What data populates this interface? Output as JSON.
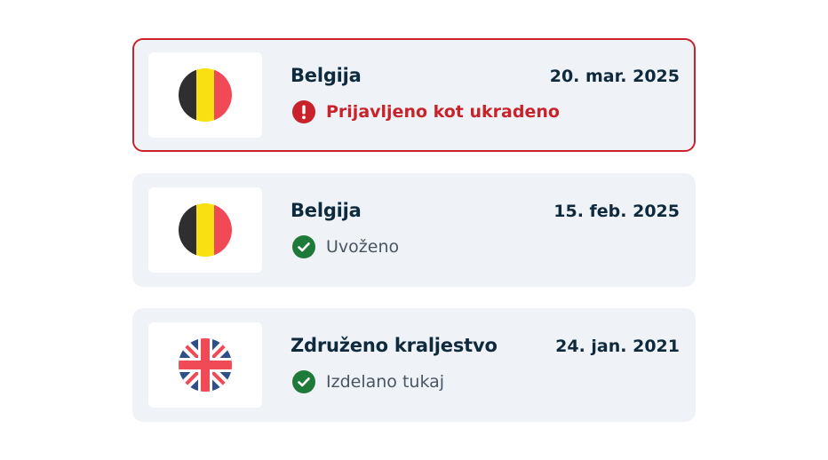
{
  "colors": {
    "card_bg": "#eff3f8",
    "alert_border": "#c8232b",
    "alert_text": "#c8232b",
    "success": "#1f7a3a",
    "heading": "#0f2a3d",
    "muted": "#4a5563"
  },
  "entries": [
    {
      "country": "Belgija",
      "date": "20. mar. 2025",
      "status": "Prijavljeno kot ukradeno",
      "status_type": "alert",
      "flag_icon": "belgium-flag-icon",
      "status_icon": "exclamation-circle-icon"
    },
    {
      "country": "Belgija",
      "date": "15. feb. 2025",
      "status": "Uvoženo",
      "status_type": "ok",
      "flag_icon": "belgium-flag-icon",
      "status_icon": "check-circle-icon"
    },
    {
      "country": "Združeno kraljestvo",
      "date": "24. jan. 2021",
      "status": "Izdelano tukaj",
      "status_type": "ok",
      "flag_icon": "uk-flag-icon",
      "status_icon": "check-circle-icon"
    }
  ]
}
